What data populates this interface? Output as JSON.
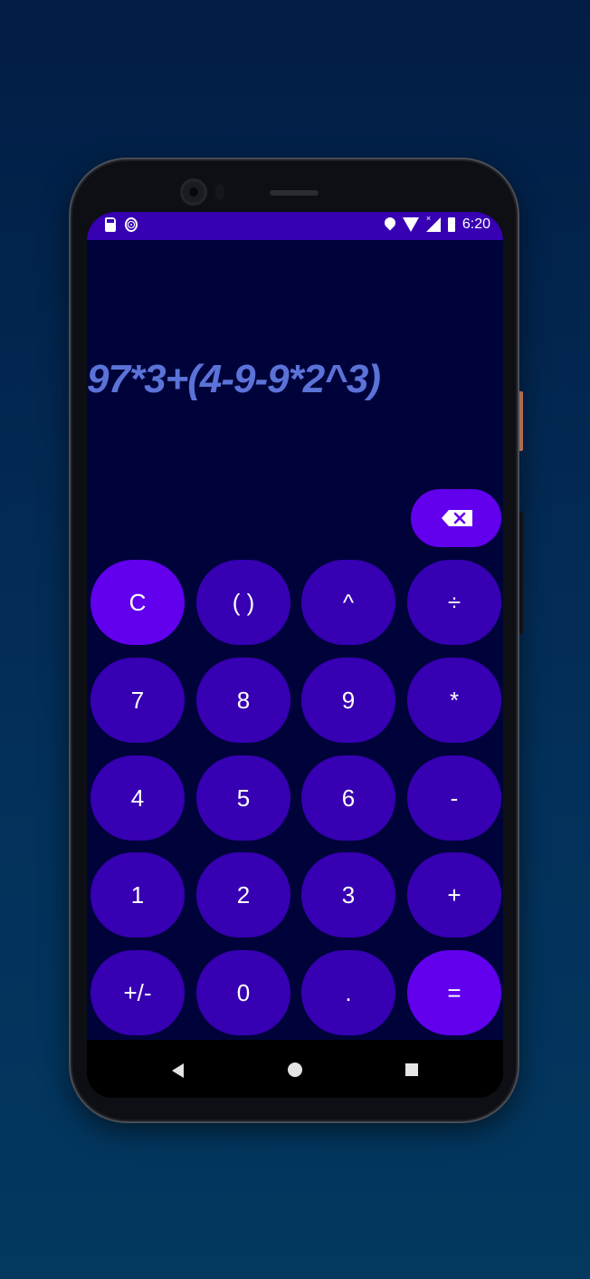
{
  "status_bar": {
    "time": "6:20",
    "icons": [
      "sd-card-icon",
      "fingerprint-icon",
      "location-icon",
      "wifi-icon",
      "cell-signal-icon",
      "battery-icon"
    ]
  },
  "display": {
    "expression": "97*3+(4-9-9*2^3)"
  },
  "backspace": {
    "icon": "backspace-icon"
  },
  "keys": [
    {
      "label": "C"
    },
    {
      "label": "( )"
    },
    {
      "label": "^"
    },
    {
      "label": "÷"
    },
    {
      "label": "7"
    },
    {
      "label": "8"
    },
    {
      "label": "9"
    },
    {
      "label": "*"
    },
    {
      "label": "4"
    },
    {
      "label": "5"
    },
    {
      "label": "6"
    },
    {
      "label": "-"
    },
    {
      "label": "1"
    },
    {
      "label": "2"
    },
    {
      "label": "3"
    },
    {
      "label": "+"
    },
    {
      "label": "+/-"
    },
    {
      "label": "0"
    },
    {
      "label": "."
    },
    {
      "label": "="
    }
  ],
  "colors": {
    "key": "#3700b3",
    "key_accent": "#6200ee",
    "display_text": "#5b73d8",
    "screen_background": "#00033a"
  }
}
